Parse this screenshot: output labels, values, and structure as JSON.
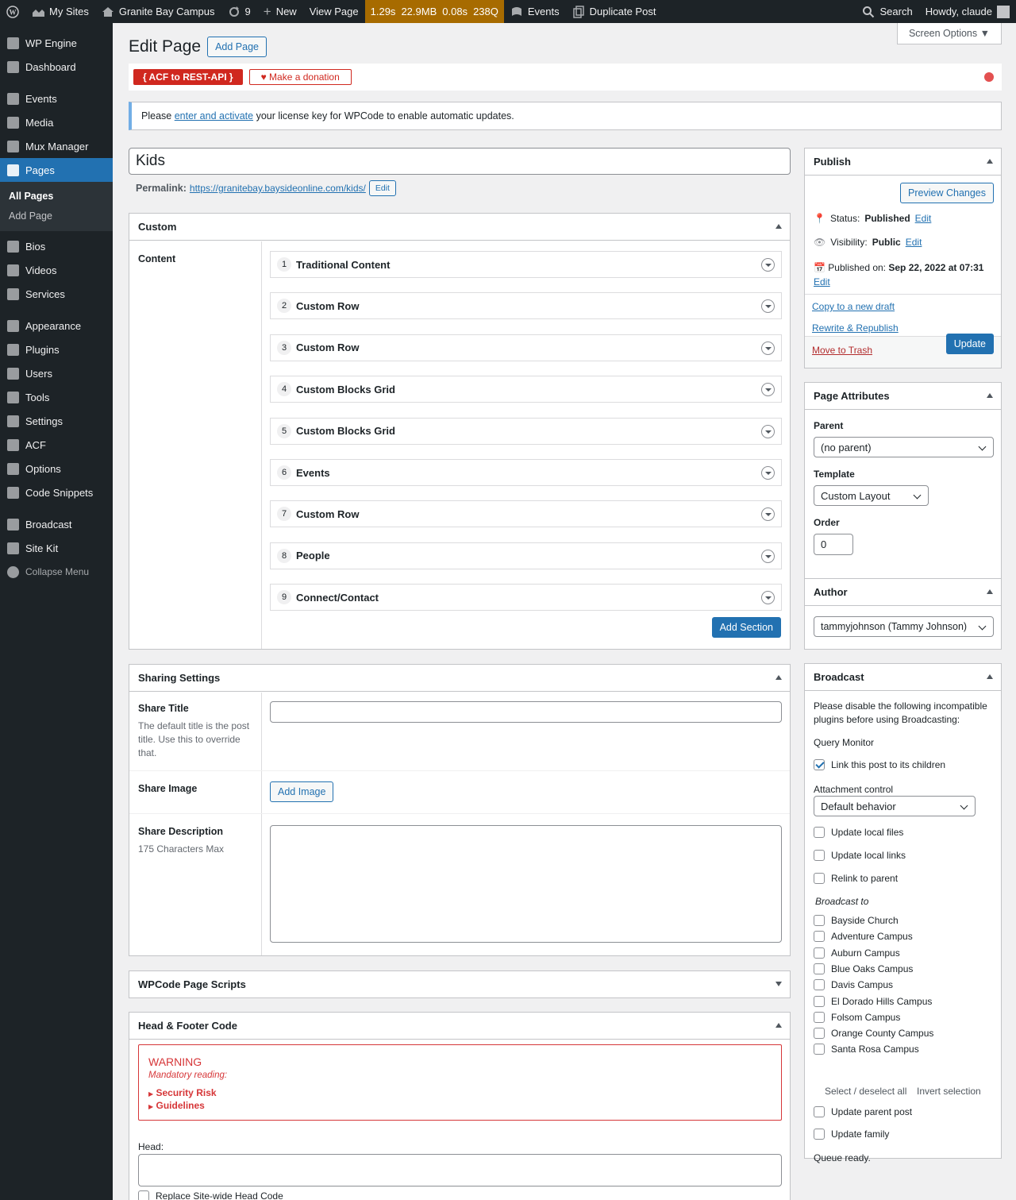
{
  "adminbar": {
    "my_sites": "My Sites",
    "site_name": "Granite Bay Campus",
    "updates_count": "9",
    "new_label": "New",
    "view_page": "View Page",
    "qm_time": "1.29s",
    "qm_mem": "22.9MB",
    "qm_db": "0.08s",
    "qm_queries": "238Q",
    "events": "Events",
    "duplicate": "Duplicate Post",
    "search": "Search",
    "howdy": "Howdy, claude"
  },
  "sidebar": {
    "items": [
      {
        "label": "WP Engine",
        "icon": "grid-icon"
      },
      {
        "label": "Dashboard",
        "icon": "dashboard-icon"
      },
      {
        "label": "Events",
        "icon": "events-icon"
      },
      {
        "label": "Media",
        "icon": "media-icon"
      },
      {
        "label": "Mux Manager",
        "icon": "video-icon"
      },
      {
        "label": "Pages",
        "icon": "pages-icon"
      },
      {
        "label": "Bios",
        "icon": "group-icon"
      },
      {
        "label": "Videos",
        "icon": "video-icon"
      },
      {
        "label": "Services",
        "icon": "services-icon"
      },
      {
        "label": "Appearance",
        "icon": "brush-icon"
      },
      {
        "label": "Plugins",
        "icon": "plugin-icon"
      },
      {
        "label": "Users",
        "icon": "user-icon"
      },
      {
        "label": "Tools",
        "icon": "wrench-icon"
      },
      {
        "label": "Settings",
        "icon": "settings-icon"
      },
      {
        "label": "ACF",
        "icon": "acf-icon"
      },
      {
        "label": "Options",
        "icon": "gear-icon"
      },
      {
        "label": "Code Snippets",
        "icon": "code-icon"
      },
      {
        "label": "Broadcast",
        "icon": "rss-icon"
      },
      {
        "label": "Site Kit",
        "icon": "google-icon"
      },
      {
        "label": "Collapse Menu",
        "icon": "collapse-icon"
      }
    ],
    "sub": {
      "all_pages": "All Pages",
      "add_page": "Add Page"
    }
  },
  "header": {
    "title": "Edit Page",
    "add_page": "Add Page",
    "screen_options": "Screen Options"
  },
  "acf": {
    "rest_api": "{ ACF to REST-API }",
    "donate": "Make a donation"
  },
  "notice": {
    "pre": "Please",
    "link": "enter and activate",
    "post": "your license key for WPCode to enable automatic updates."
  },
  "post": {
    "title": "Kids",
    "permalink_label": "Permalink:",
    "permalink_url": "https://granitebay.baysideonline.com/kids/",
    "edit": "Edit"
  },
  "custom": {
    "title": "Custom",
    "content_label": "Content",
    "rows": [
      {
        "num": "1",
        "label": "Traditional Content"
      },
      {
        "num": "2",
        "label": "Custom Row"
      },
      {
        "num": "3",
        "label": "Custom Row"
      },
      {
        "num": "4",
        "label": "Custom Blocks Grid"
      },
      {
        "num": "5",
        "label": "Custom Blocks Grid"
      },
      {
        "num": "6",
        "label": "Events"
      },
      {
        "num": "7",
        "label": "Custom Row"
      },
      {
        "num": "8",
        "label": "People"
      },
      {
        "num": "9",
        "label": "Connect/Contact"
      }
    ],
    "add_section": "Add Section"
  },
  "sharing": {
    "title": "Sharing Settings",
    "share_title": "Share Title",
    "share_title_desc": "The default title is the post title. Use this to override that.",
    "share_image": "Share Image",
    "add_image": "Add Image",
    "share_desc": "Share Description",
    "share_desc_hint": "175 Characters Max"
  },
  "wpcode": {
    "title": "WPCode Page Scripts"
  },
  "headfooter": {
    "title": "Head & Footer Code",
    "warning": "WARNING",
    "mandatory": "Mandatory reading:",
    "security": "Security Risk",
    "guidelines": "Guidelines",
    "head_label": "Head:",
    "replace": "Replace Site-wide Head Code"
  },
  "publish": {
    "title": "Publish",
    "preview": "Preview Changes",
    "status_label": "Status:",
    "status_value": "Published",
    "visibility_label": "Visibility:",
    "visibility_value": "Public",
    "published_label": "Published on:",
    "published_value": "Sep 22, 2022 at 07:31",
    "edit": "Edit",
    "copy_draft": "Copy to a new draft",
    "rewrite": "Rewrite & Republish",
    "trash": "Move to Trash",
    "update": "Update"
  },
  "attributes": {
    "title": "Page Attributes",
    "parent_label": "Parent",
    "parent_value": "(no parent)",
    "template_label": "Template",
    "template_value": "Custom Layout",
    "order_label": "Order",
    "order_value": "0"
  },
  "author": {
    "title": "Author",
    "value": "tammyjohnson (Tammy Johnson)"
  },
  "broadcast": {
    "title": "Broadcast",
    "incompat": "Please disable the following incompatible plugins before using Broadcasting:",
    "plugin": "Query Monitor",
    "link_children": "Link this post to its children",
    "attach_label": "Attachment control",
    "attach_value": "Default behavior",
    "update_files": "Update local files",
    "update_links": "Update local links",
    "relink": "Relink to parent",
    "broadcast_to": "Broadcast to",
    "sites": [
      "Bayside Church",
      "Adventure Campus",
      "Auburn Campus",
      "Blue Oaks Campus",
      "Davis Campus",
      "El Dorado Hills Campus",
      "Folsom Campus",
      "Orange County Campus",
      "Santa Rosa Campus"
    ],
    "select_all": "Select / deselect all",
    "invert": "Invert selection",
    "update_parent": "Update parent post",
    "update_family": "Update family",
    "queue": "Queue ready."
  },
  "colors": {
    "accent": "#2271b1",
    "adminbar": "#1d2327",
    "qm": "#a76b00",
    "danger": "#d63638"
  }
}
